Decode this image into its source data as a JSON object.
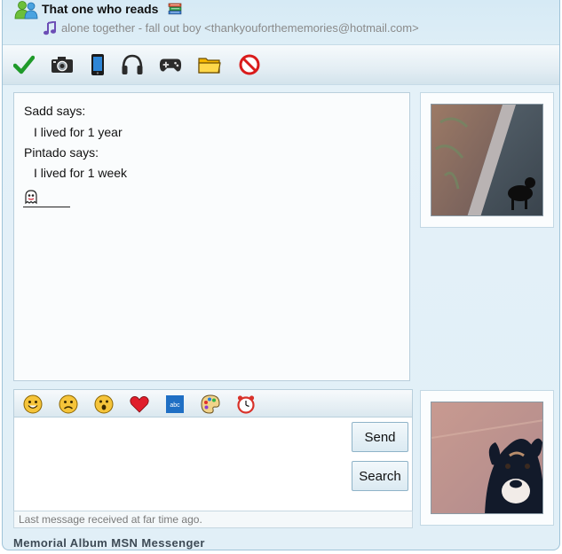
{
  "header": {
    "contact_name": "That one who reads",
    "status_line": "alone together - fall out boy <thankyouforthememories@hotmail.com>"
  },
  "toolbar": {
    "items": [
      {
        "name": "status-online",
        "icon": "checkmark-icon"
      },
      {
        "name": "webcam",
        "icon": "camera-icon"
      },
      {
        "name": "mobile",
        "icon": "phone-icon"
      },
      {
        "name": "audio",
        "icon": "headphones-icon"
      },
      {
        "name": "games",
        "icon": "gamepad-icon"
      },
      {
        "name": "files",
        "icon": "folder-icon"
      },
      {
        "name": "block",
        "icon": "block-icon"
      }
    ]
  },
  "conversation": {
    "messages": [
      {
        "sender": "Sadd says:",
        "text": "I lived for 1 year"
      },
      {
        "sender": "Pintado says:",
        "text": "I lived for 1 week"
      }
    ]
  },
  "emoticons": [
    {
      "icon": "smile-icon"
    },
    {
      "icon": "sad-icon"
    },
    {
      "icon": "surprised-icon"
    },
    {
      "icon": "heart-icon"
    },
    {
      "icon": "font-icon",
      "label": "abc"
    },
    {
      "icon": "palette-icon"
    },
    {
      "icon": "alarm-clock-icon"
    }
  ],
  "input": {
    "value": "",
    "send_label": "Send",
    "search_label": "Search"
  },
  "status": "Last message received at far time ago.",
  "footer": "Memorial Album MSN Messenger",
  "colors": {
    "window_bg": "#dcedf6",
    "accent_border": "#9fc3d8",
    "status_text": "#8a8a8a"
  }
}
